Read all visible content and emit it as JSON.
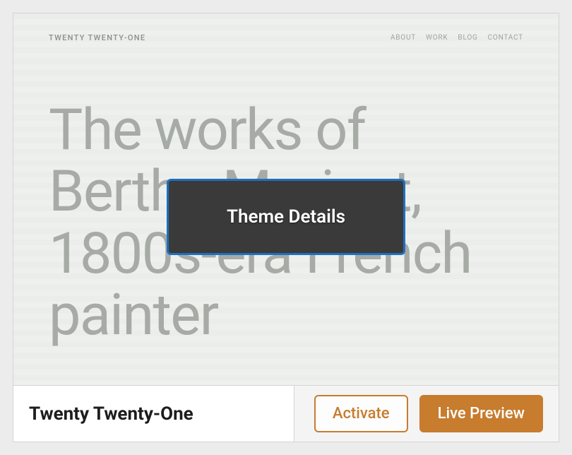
{
  "overlay": {
    "label": "Theme Details"
  },
  "screenshot": {
    "site_title": "TWENTY TWENTY-ONE",
    "nav": [
      "ABOUT",
      "WORK",
      "BLOG",
      "CONTACT"
    ],
    "hero": "The works of Berthe Morisot, 1800s-era French painter"
  },
  "theme": {
    "name": "Twenty Twenty-One"
  },
  "actions": {
    "activate": "Activate",
    "live_preview": "Live Preview"
  }
}
